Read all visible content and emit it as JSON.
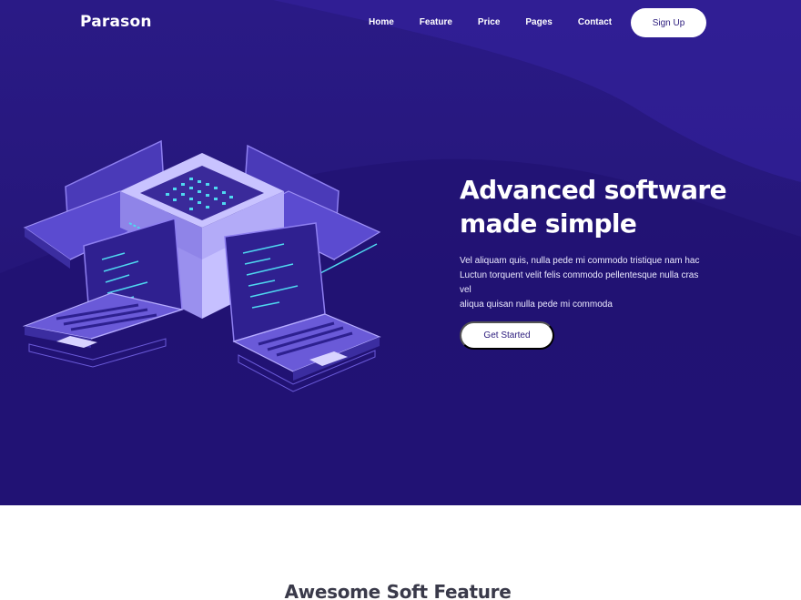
{
  "brand": {
    "logo": "Parason"
  },
  "nav": {
    "items": [
      "Home",
      "Feature",
      "Price",
      "Pages",
      "Contact"
    ],
    "signup_label": "Sign Up"
  },
  "hero": {
    "headline_line1": "Advanced software",
    "headline_line2": "made simple",
    "description_line1": "Vel aliquam quis, nulla pede mi commodo tristique nam hac",
    "description_line2": "Luctun torquent velit felis commodo pellentesque nulla cras vel",
    "description_line3": "aliqua quisan nulla pede mi commoda",
    "cta_label": "Get Started",
    "illustration": "isometric-server-laptops-illustration"
  },
  "features": {
    "title": "Awesome Soft Feature"
  },
  "colors": {
    "hero_bg": "#271880",
    "button_bg": "#ffffff",
    "button_text": "#2a1a7c",
    "accent_cyan": "#4fd8f0",
    "section_title": "#3a3a4a"
  }
}
